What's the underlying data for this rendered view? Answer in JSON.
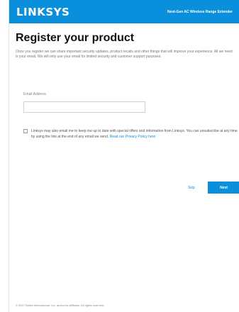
{
  "header": {
    "logo": "LINKSYS",
    "product_name": "Next-Gen AC Wireless Range Extender"
  },
  "page": {
    "title": "Register your product",
    "intro": "Once you register we can share important security updates, product recalls and other things that will improve your experience. All we need is your email. We will only use your email for limited security and customer support purposes."
  },
  "form": {
    "email_label": "Email Address",
    "email_value": "",
    "optin_text": "Linksys may also email me to keep me up to date with special offers and information from Linksys. You can unsubscribe at any time by using the link at the end of any email we send.",
    "policy_link": "Read our Privacy Policy here",
    "optin_checked": false
  },
  "actions": {
    "skip_label": "Skip",
    "next_label": "Next"
  },
  "footer": {
    "copyright": "© 2017 Belkin International, Inc. and/or its affiliates. All rights reserved."
  },
  "colors": {
    "brand": "#0a8fdc"
  }
}
